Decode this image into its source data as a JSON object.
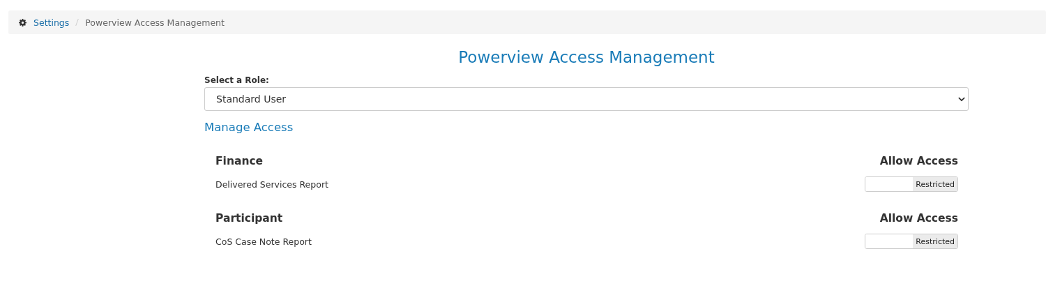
{
  "breadcrumb": [
    {
      "label": "Settings",
      "kind": "link"
    },
    {
      "label": "Powerview Access Management",
      "kind": "current"
    }
  ],
  "title": "Powerview Access Management",
  "role_select": {
    "label": "Select a Role:",
    "value": "Standard User"
  },
  "manage_heading": "Manage Access",
  "sections": [
    {
      "name": "Finance",
      "column_heading": "Allow Access",
      "items": [
        {
          "label": "Delivered Services Report",
          "toggle": {
            "text": "Restricted",
            "on": false
          }
        }
      ]
    },
    {
      "name": "Participant",
      "column_heading": "Allow Access",
      "items": [
        {
          "label": "CoS Case Note Report",
          "toggle": {
            "text": "Restricted",
            "on": false
          }
        }
      ]
    }
  ]
}
